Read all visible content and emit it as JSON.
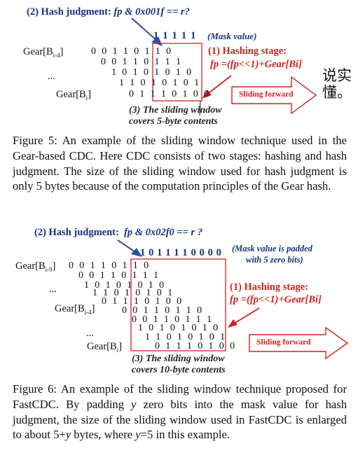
{
  "fig5": {
    "judgment_prefix": "(2) Hash judgment: ",
    "judgment_expr": "fp & 0x001f == r?",
    "mask_bits": "1 1 1 1 1",
    "mask_label": "(Mask value)",
    "gear_top_label": "Gear[B",
    "gear_top_sub": "i-4",
    "gear_bottom_label": "Gear[B",
    "gear_bottom_sub": "i",
    "ellipsis": "...",
    "rows": [
      "0 0 1 1 0 1 1 0",
      "0 0 1 1 0 1 1 1",
      "1 0 1 0 1 0 1 0",
      "1 1 0 1 0 1 0 1",
      "0 1 1 1 0 1 0 0"
    ],
    "hashing_title": "(1) Hashing stage:",
    "hashing_expr": "fp =(fp<<1)+Gear[Bi]",
    "sliding_forward": "Sliding forward",
    "window_line1": "(3) The sliding window",
    "window_line2": "covers 5-byte contents",
    "cjk_note_line1": "说实",
    "cjk_note_line2": "懂。",
    "caption": "Figure 5: An example of the sliding window technique used in the Gear-based CDC. Here CDC consists of two stages: hashing and hash judgment. The size of the sliding window used for hash judgment is only 5 bytes because of the computation principles of the Gear hash."
  },
  "fig6": {
    "judgment_prefix": "(2) Hash judgment:",
    "judgment_expr": "fp & 0x02f0 == r ?",
    "mask_bits": "1 0 1 1 1 1 0 0 0 0",
    "mask_label_line1": "(Mask value is padded",
    "mask_label_line2": "with 5 zero bits)",
    "gear_top_label": "Gear[B",
    "gear_top_sub": "i-9",
    "gear_mid_label": "Gear[B",
    "gear_mid_sub": "i-4",
    "gear_bottom_label": "Gear[B",
    "gear_bottom_sub": "i",
    "ellipsis": "...",
    "rows": [
      "0 0 1 1 0 1 1 0",
      "0 0 1 1 0 1 1 1",
      "1 0 1 0 1 0 1 0",
      "1 1 0 1 0 1 0 1",
      "0 1 1 1 0 1 0 0",
      "0 0 1 1 0 1 1 0",
      "0 0 1 1 0 1 1 1",
      "1 0 1 0 1 0 1 0",
      "1 1 0 1 0 1 0 1",
      "0 1 1 1 0 1 0 0"
    ],
    "hashing_title": "(1) Hashing stage:",
    "hashing_expr": "fp =(fp<<1)+Gear[Bi]",
    "sliding_forward": "Sliding forward",
    "window_line1": "(3) The sliding window",
    "window_line2": "covers 10-byte contents",
    "caption_parts": [
      "Figure 6: An example of the sliding window technique proposed for FastCDC. By padding ",
      "y",
      " zero bits into the mask value for hash judgment, the size of the sliding window used in FastCDC is enlarged to about 5+",
      "y",
      " bytes, where ",
      "y",
      "=5 in this example."
    ]
  }
}
